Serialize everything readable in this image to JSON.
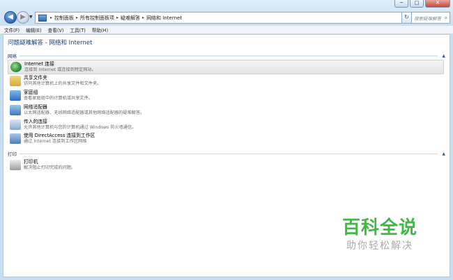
{
  "window": {
    "controls": {
      "minimize": "─",
      "maximize": "□",
      "close": "✕"
    }
  },
  "nav": {
    "back": "◀",
    "forward": "▶",
    "history_drop": "▼",
    "breadcrumbs": [
      "控制面板",
      "所有控制面板项",
      "疑难解答",
      "网络和 Internet"
    ],
    "address_drop": "▼",
    "refresh": "↻",
    "search_placeholder": "搜索疑难解答",
    "search_icon": "⌕"
  },
  "menu": [
    "文件(F)",
    "编辑(E)",
    "查看(V)",
    "工具(T)",
    "帮助(H)"
  ],
  "page_title": "问题疑难解答 - 网络和 Internet",
  "groups": [
    {
      "name": "网络",
      "items": [
        {
          "name": "Internet 连接",
          "desc": "连接到 Internet 或连接到特定网站。",
          "icon": "globe-network-icon"
        },
        {
          "name": "共享文件夹",
          "desc": "访问其他计算机上的共享文件和文件夹。",
          "icon": "shared-folder-icon"
        },
        {
          "name": "家庭组",
          "desc": "查看家庭组中的计算机或共享文件。",
          "icon": "homegroup-icon"
        },
        {
          "name": "网络适配器",
          "desc": "以太网适配器、无线网络适配器或其他网络适配器的疑难解答。",
          "icon": "network-adapter-icon"
        },
        {
          "name": "传入的连接",
          "desc": "允许其他计算机与您的计算机通过 Windows 防火墙通信。",
          "icon": "incoming-connection-icon"
        },
        {
          "name": "使用 DirectAccess 连接到工作区",
          "desc": "通过 Internet 连接到工作区网络",
          "icon": "directaccess-icon"
        }
      ]
    },
    {
      "name": "打印",
      "items": [
        {
          "name": "打印机",
          "desc": "解决阻止打印完成的问题。",
          "icon": "printer-icon"
        }
      ]
    }
  ],
  "collapse_icon": "▲",
  "watermark": {
    "title": "百科全说",
    "subtitle": "助你轻松解决"
  }
}
